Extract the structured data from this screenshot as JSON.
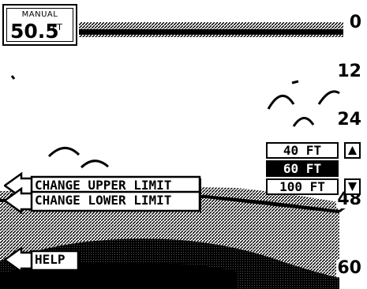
{
  "mode": {
    "label": "MANUAL",
    "depth_value": "50.5",
    "depth_unit": "FT"
  },
  "depth_scale": [
    "0",
    "12",
    "24",
    "48",
    "60"
  ],
  "range_options": [
    {
      "label": "40 FT",
      "selected": false
    },
    {
      "label": "60 FT",
      "selected": true
    },
    {
      "label": "100 FT",
      "selected": false
    }
  ],
  "range_arrows": {
    "up_icon": "triangle-up-icon",
    "down_icon": "triangle-down-icon"
  },
  "menu": [
    {
      "label": "CHANGE UPPER LIMIT"
    },
    {
      "label": "CHANGE LOWER LIMIT"
    },
    {
      "label": "HELP"
    }
  ]
}
